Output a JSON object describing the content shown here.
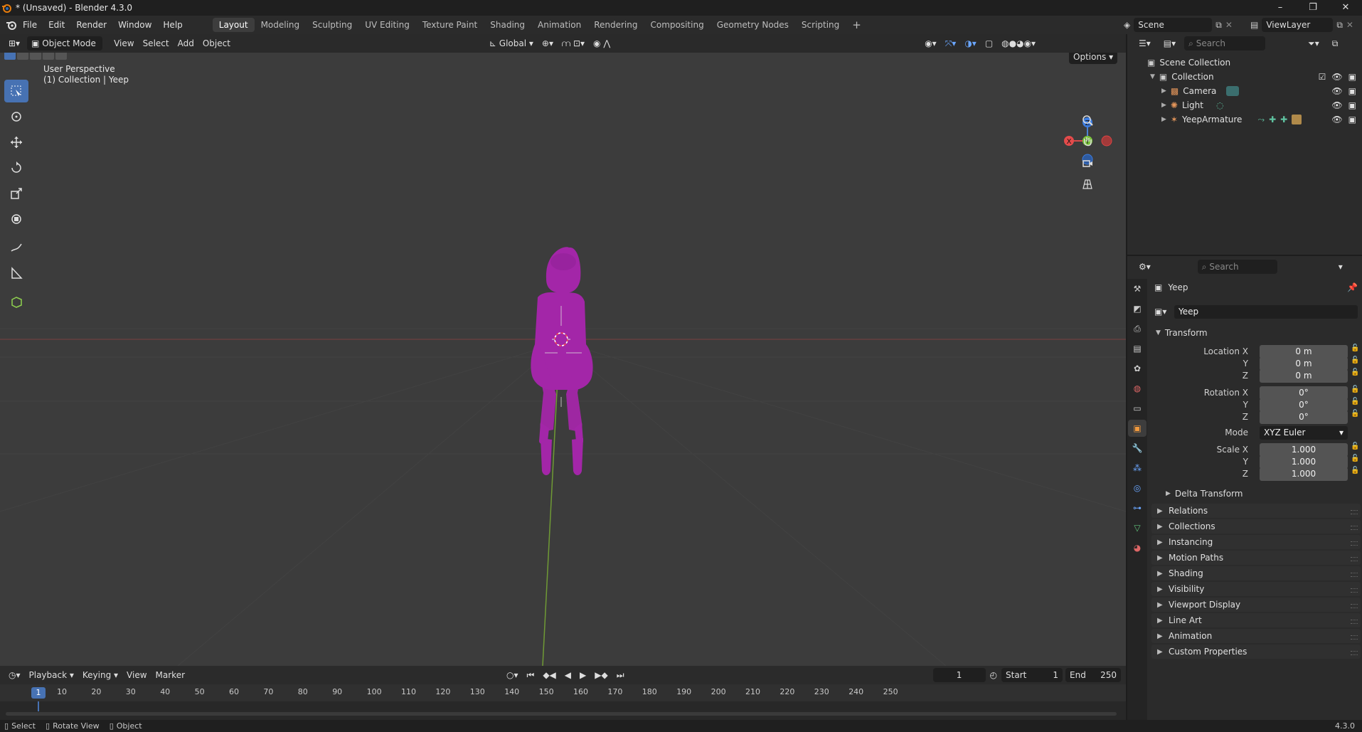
{
  "window": {
    "title": "* (Unsaved) - Blender 4.3.0",
    "controls": [
      "minimize",
      "maximize",
      "close"
    ]
  },
  "menu": {
    "items": [
      "File",
      "Edit",
      "Render",
      "Window",
      "Help"
    ],
    "workspaces": [
      "Layout",
      "Modeling",
      "Sculpting",
      "UV Editing",
      "Texture Paint",
      "Shading",
      "Animation",
      "Rendering",
      "Compositing",
      "Geometry Nodes",
      "Scripting"
    ],
    "active_workspace": "Layout",
    "add_workspace": "+",
    "scene": "Scene",
    "view_layer": "ViewLayer"
  },
  "viewport_header": {
    "mode": "Object Mode",
    "menus": [
      "View",
      "Select",
      "Add",
      "Object"
    ],
    "orientation": "Global",
    "options_label": "Options"
  },
  "viewport": {
    "perspective_label": "User Perspective",
    "collection_label": "(1) Collection | Yeep",
    "gizmo_axes": [
      "Z",
      "X",
      "Y"
    ],
    "model_color": "#a326a8",
    "background_color": "#3c3c3c"
  },
  "timeline": {
    "menus": [
      "Playback",
      "Keying",
      "View",
      "Marker"
    ],
    "current_frame": "1",
    "start_label": "Start",
    "start_value": "1",
    "end_label": "End",
    "end_value": "250",
    "ruler_marks": [
      "10",
      "20",
      "30",
      "40",
      "50",
      "60",
      "70",
      "80",
      "90",
      "100",
      "110",
      "120",
      "130",
      "140",
      "150",
      "160",
      "170",
      "180",
      "190",
      "200",
      "210",
      "220",
      "230",
      "240",
      "250"
    ]
  },
  "statusbar": {
    "items": [
      "Select",
      "Rotate View",
      "Object"
    ],
    "version": "4.3.0"
  },
  "outliner": {
    "search_placeholder": "Search",
    "scene_collection": "Scene Collection",
    "collection": "Collection",
    "objects": [
      "Camera",
      "Light",
      "YeepArmature"
    ]
  },
  "properties": {
    "search_placeholder": "Search",
    "object_name": "Yeep",
    "object_field": "Yeep",
    "transform_label": "Transform",
    "location_label": "Location X",
    "location": [
      "0 m",
      "0 m",
      "0 m"
    ],
    "rotation_label": "Rotation X",
    "rotation": [
      "0°",
      "0°",
      "0°"
    ],
    "mode_label": "Mode",
    "mode_value": "XYZ Euler",
    "scale_label": "Scale X",
    "scale": [
      "1.000",
      "1.000",
      "1.000"
    ],
    "axis_y": "Y",
    "axis_z": "Z",
    "delta_transform": "Delta Transform",
    "panels": [
      "Relations",
      "Collections",
      "Instancing",
      "Motion Paths",
      "Shading",
      "Visibility",
      "Viewport Display",
      "Line Art",
      "Animation",
      "Custom Properties"
    ]
  }
}
